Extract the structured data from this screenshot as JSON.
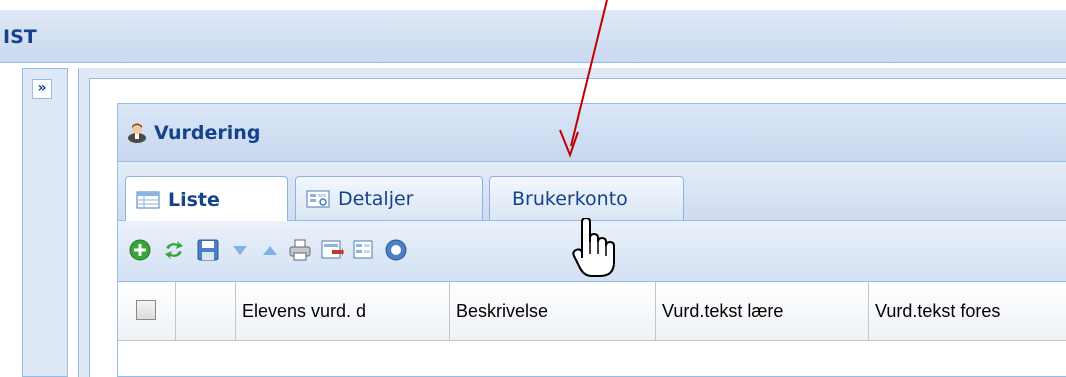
{
  "app": {
    "title": "IST"
  },
  "sidebar": {
    "expand_label": "»"
  },
  "panel": {
    "title": "Vurdering",
    "icon": "user-icon"
  },
  "tabs": [
    {
      "label": "Liste",
      "icon": "table-icon",
      "active": true
    },
    {
      "label": "Detaljer",
      "icon": "form-detail-icon",
      "active": false
    },
    {
      "label": "Brukerkonto",
      "icon": "",
      "active": false
    }
  ],
  "toolbar": {
    "buttons": [
      {
        "name": "add-icon"
      },
      {
        "name": "refresh-icon"
      },
      {
        "name": "save-icon"
      },
      {
        "name": "move-down-icon"
      },
      {
        "name": "move-up-icon"
      },
      {
        "name": "print-icon"
      },
      {
        "name": "export-icon"
      },
      {
        "name": "import-icon"
      },
      {
        "name": "help-icon"
      }
    ]
  },
  "grid": {
    "columns": [
      "",
      "Elevens vurd. d",
      "Beskrivelse",
      "Vurd.tekst lære",
      "Vurd.tekst fores"
    ]
  },
  "colors": {
    "header_text": "#15428b",
    "border": "#99bbe8",
    "annotation_arrow": "#c00000"
  }
}
